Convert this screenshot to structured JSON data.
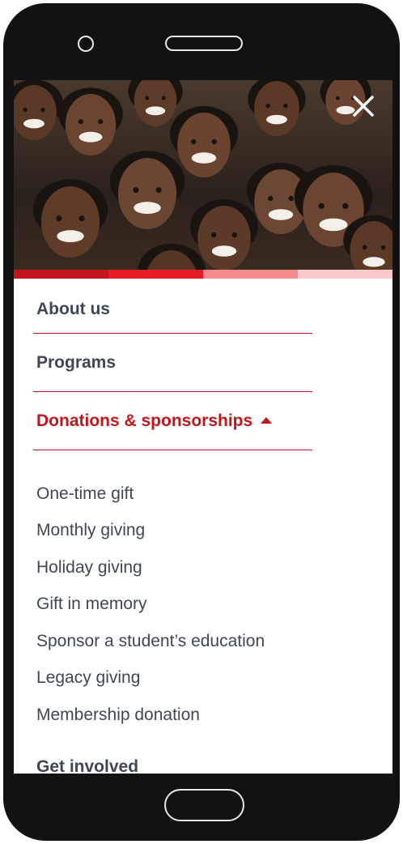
{
  "colors": {
    "accent": "#c2161c",
    "text": "#3e4755",
    "progress": [
      "#c2161c",
      "#e41d24",
      "#f28c8c",
      "#f7c9c9"
    ]
  },
  "hero": {
    "image_name": "smiling-children-photo"
  },
  "nav": {
    "close_icon": "close-icon",
    "items": [
      {
        "label": "About us"
      },
      {
        "label": "Programs"
      },
      {
        "label": "Donations & sponsorships",
        "expanded": true
      }
    ],
    "submenu": [
      {
        "label": "One-time gift"
      },
      {
        "label": "Monthly giving"
      },
      {
        "label": "Holiday giving"
      },
      {
        "label": "Gift in memory"
      },
      {
        "label": "Sponsor a student’s education"
      },
      {
        "label": "Legacy giving"
      },
      {
        "label": "Membership donation"
      }
    ],
    "next_item": {
      "label": "Get involved"
    }
  }
}
